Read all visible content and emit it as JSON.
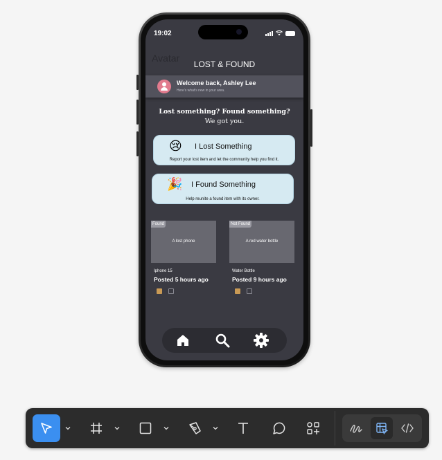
{
  "phone": {
    "status_bar": {
      "time": "19:02"
    },
    "ghost_label": "Avatar",
    "app_title": "LOST & FOUND",
    "welcome": {
      "title": "Welcome back, Ashley Lee",
      "subtitle": "Here's what's new in your area."
    },
    "headline": {
      "line1": "Lost something? Found something?",
      "line2": "We got you."
    },
    "actions": [
      {
        "emoji": "😢",
        "label": "I Lost Something",
        "description": "Report your lost item and let the community help you find it."
      },
      {
        "emoji": "🎉",
        "label": "I Found Something",
        "description": "Help reunite a found item with its owner."
      }
    ],
    "posts": [
      {
        "badge": "Found",
        "image_alt": "A lost phone",
        "name": "Iphone 15",
        "posted": "Posted 5 hours ago"
      },
      {
        "badge": "Not Found",
        "image_alt": "A red water bottle",
        "name": "Water Bottle",
        "posted": "Posted 9 hours ago"
      }
    ],
    "bottom_nav": [
      "home-icon",
      "search-icon",
      "settings-icon"
    ]
  },
  "toolbar": {
    "tools": [
      "move-tool",
      "frame-tool",
      "shape-tool",
      "pen-tool",
      "text-tool",
      "comment-tool",
      "actions-tool"
    ],
    "active_tool": "move-tool",
    "modes": [
      "draw-mode",
      "design-mode",
      "dev-mode"
    ],
    "active_mode": "design-mode",
    "colors": {
      "active": "#3b8ff0",
      "background": "#2c2c2c"
    }
  },
  "colors": {
    "screen": "#3a3a42",
    "card": "#d6eaf2",
    "avatar": "#e27b8e"
  }
}
